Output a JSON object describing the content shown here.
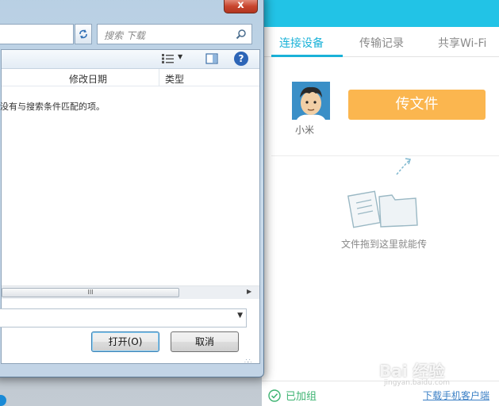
{
  "dialog": {
    "close_glyph": "x",
    "search_placeholder": "搜索 下载",
    "columns": [
      "修改日期",
      "类型"
    ],
    "empty_message": "没有与搜索条件匹配的项。",
    "scroll_grip": "III",
    "open_button": "打开(O)",
    "cancel_button": "取消"
  },
  "app": {
    "tabs": [
      {
        "label": "连接设备",
        "active": true
      },
      {
        "label": "传输记录",
        "active": false
      },
      {
        "label": "共享Wi-Fi",
        "active": false
      }
    ],
    "device_name": "小米",
    "send_button": "传文件",
    "drop_hint": "文件拖到这里就能传",
    "status": "已加组",
    "download_link": "下载手机客户端",
    "colors": {
      "header": "#22c3e6",
      "accent": "#1ab2d8",
      "send": "#fbb64f",
      "status": "#3cb371"
    }
  },
  "watermark": {
    "text": "Bai 经验",
    "sub": "jingyan.baidu.com"
  }
}
